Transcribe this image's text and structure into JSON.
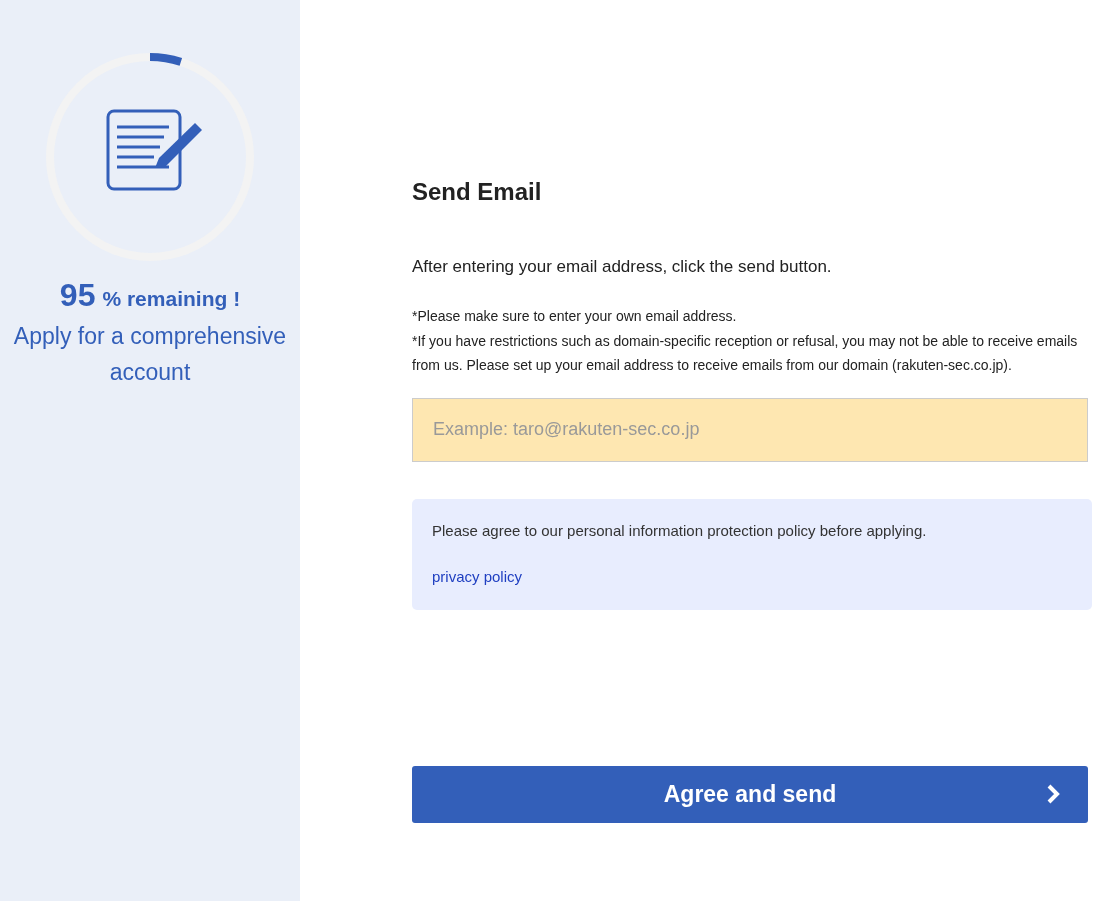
{
  "progress": {
    "level": 0.05,
    "number": "95",
    "suffix": "% remaining !",
    "caption": "Apply for a comprehensive account"
  },
  "title": "Send Email",
  "instruction": "After entering your email address, click the send button.",
  "notes": [
    "*Please make sure to enter your own email address.",
    "*If you have restrictions such as domain-specific reception or refusal, you may not be able to receive emails from us. Please set up your email address to receive emails from our domain (rakuten-sec.co.jp)."
  ],
  "email_field": {
    "placeholder": "Example: taro@rakuten-sec.co.jp"
  },
  "notice": {
    "text": "Please agree to our personal information protection policy before applying.",
    "link": "privacy policy"
  },
  "submit_button": {
    "label": "Agree and send"
  }
}
